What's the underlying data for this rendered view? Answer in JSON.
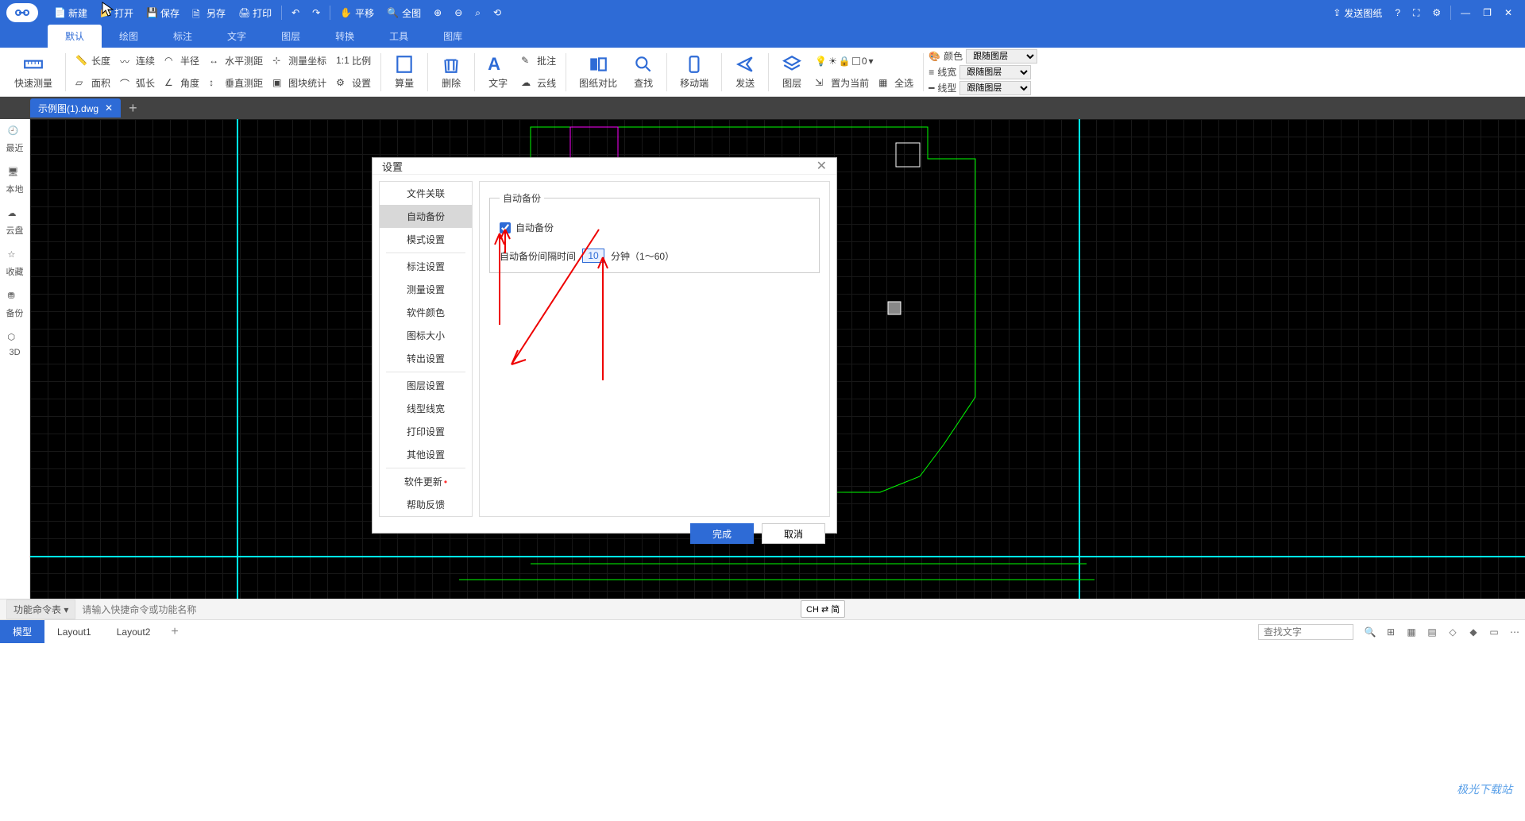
{
  "titlebar": {
    "new": "新建",
    "open": "打开",
    "save": "保存",
    "saveas": "另存",
    "print": "打印",
    "pan": "平移",
    "fit": "全图",
    "send": "发送图纸"
  },
  "menus": [
    "默认",
    "绘图",
    "标注",
    "文字",
    "图层",
    "转换",
    "工具",
    "图库"
  ],
  "ribbon": {
    "quickmeasure": "快速测量",
    "r1": [
      "长度",
      "连续",
      "半径",
      "水平测距",
      "测量坐标",
      "比例"
    ],
    "r2": [
      "面积",
      "弧长",
      "角度",
      "垂直测距",
      "图块统计",
      "设置"
    ],
    "calc": "算量",
    "del": "删除",
    "text": "文字",
    "annot": "批注",
    "cloud": "云线",
    "compare": "图纸对比",
    "find": "查找",
    "mobile": "移动端",
    "send2": "发送",
    "layer": "图层",
    "setcur": "置为当前",
    "selall": "全选",
    "color": "颜色",
    "lw": "线宽",
    "lt": "线型",
    "bylayer": "跟随图层",
    "layerval": "0"
  },
  "doc": {
    "name": "示例图(1).dwg"
  },
  "leftbar": [
    "最近",
    "本地",
    "云盘",
    "收藏",
    "备份",
    "3D"
  ],
  "dialog": {
    "title": "设置",
    "items": [
      "文件关联",
      "自动备份",
      "模式设置",
      "标注设置",
      "测量设置",
      "软件颜色",
      "图标大小",
      "转出设置",
      "图层设置",
      "线型线宽",
      "打印设置",
      "其他设置",
      "软件更新",
      "帮助反馈"
    ],
    "active_index": 1,
    "group_legend": "自动备份",
    "chk_label": "自动备份",
    "interval_label": "自动备份间隔时间",
    "interval_value": "10",
    "interval_suffix": "分钟（1～60）",
    "ok": "完成",
    "cancel": "取消"
  },
  "cmd": {
    "label": "功能命令表",
    "placeholder": "请输入快捷命令或功能名称",
    "chip": "CH ⇄ 简"
  },
  "bottom": {
    "tabs": [
      "模型",
      "Layout1",
      "Layout2"
    ],
    "search_ph": "查找文字"
  },
  "watermark": "极光下载站"
}
